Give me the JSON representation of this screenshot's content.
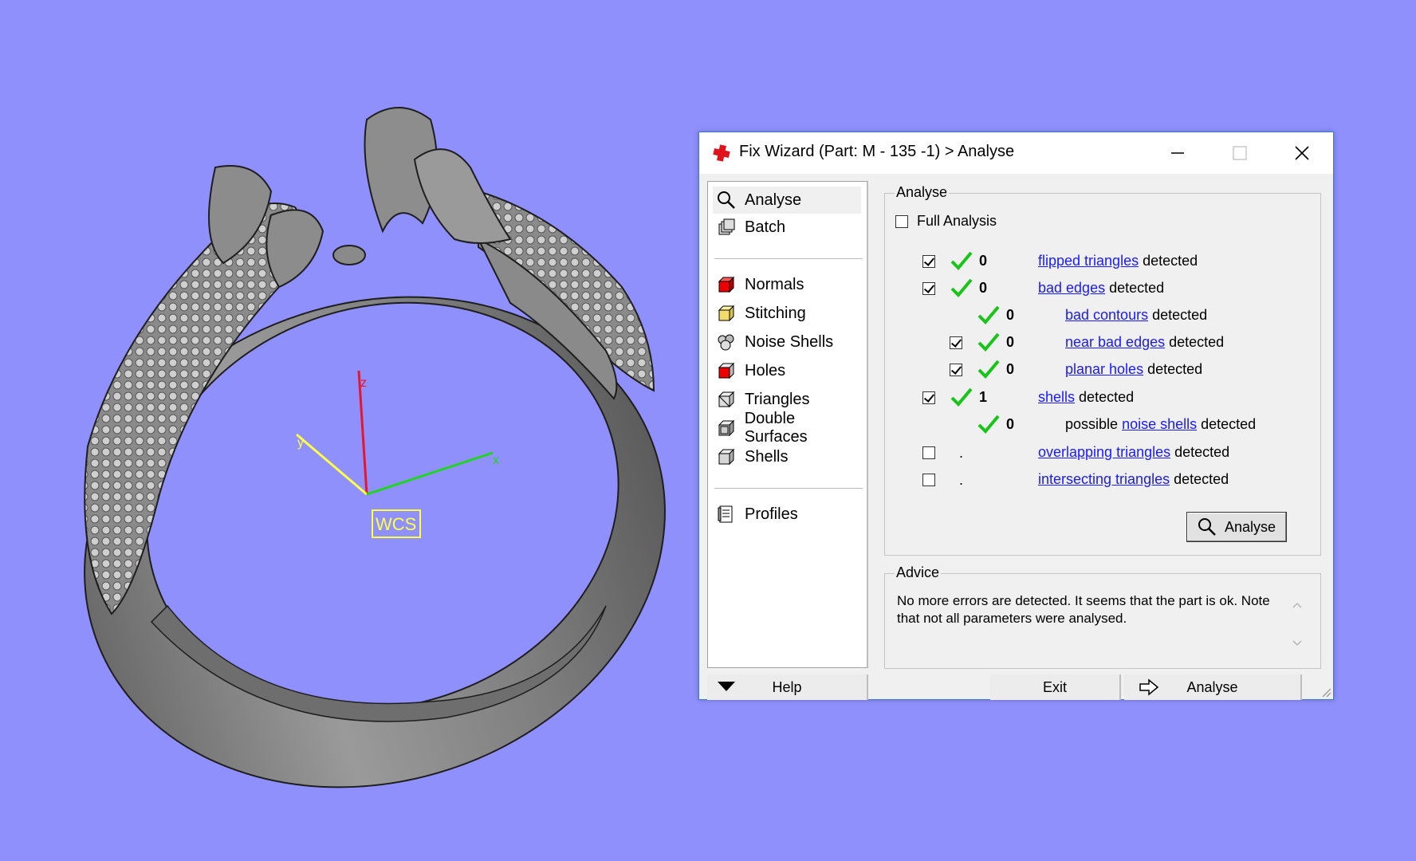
{
  "viewport": {
    "wcs_label": "WCS",
    "axis_x": "x",
    "axis_y": "y",
    "axis_z": "z"
  },
  "window": {
    "title": "Fix Wizard (Part: M - 135 -1) > Analyse",
    "minimize_symbol": "—",
    "maximize_symbol": "☐",
    "close_symbol": "✕"
  },
  "nav": {
    "items": [
      {
        "label": "Analyse",
        "icon": "magnifier-icon"
      },
      {
        "label": "Batch",
        "icon": "batch-icon"
      },
      {
        "label": "Normals",
        "icon": "normals-cube-icon"
      },
      {
        "label": "Stitching",
        "icon": "stitching-cube-icon"
      },
      {
        "label": "Noise Shells",
        "icon": "noise-shells-icon"
      },
      {
        "label": "Holes",
        "icon": "holes-cube-icon"
      },
      {
        "label": "Triangles",
        "icon": "triangles-cube-icon"
      },
      {
        "label": "Double Surfaces",
        "icon": "double-surfaces-icon"
      },
      {
        "label": "Shells",
        "icon": "shells-cube-icon"
      },
      {
        "label": "Profiles",
        "icon": "profiles-icon"
      }
    ]
  },
  "analyse": {
    "group_title": "Analyse",
    "full_analysis_label": "Full Analysis",
    "full_analysis_checked": false,
    "rows": [
      {
        "checked": true,
        "count": "0",
        "link": "flipped triangles",
        "suffix": "detected"
      },
      {
        "checked": true,
        "count": "0",
        "link": "bad edges",
        "suffix": "detected"
      },
      {
        "count": "0",
        "link": "bad contours",
        "suffix": "detected"
      },
      {
        "checked": true,
        "count": "0",
        "link": "near bad edges",
        "suffix": "detected"
      },
      {
        "checked": true,
        "count": "0",
        "link": "planar holes",
        "suffix": "detected"
      },
      {
        "checked": true,
        "count": "1",
        "link": "shells",
        "suffix": "detected"
      },
      {
        "count": "0",
        "prefix": "possible",
        "link": "noise shells",
        "suffix": "detected"
      },
      {
        "checked": false,
        "count": ".",
        "link": "overlapping triangles",
        "suffix": "detected"
      },
      {
        "checked": false,
        "count": ".",
        "link": "intersecting triangles",
        "suffix": "detected"
      }
    ],
    "analyse_button": "Analyse"
  },
  "advice": {
    "group_title": "Advice",
    "text": "No more errors are detected. It seems that the part is ok. Note that not all parameters were analysed."
  },
  "footer": {
    "help_label": "Help",
    "exit_label": "Exit",
    "analyse_label": "Analyse"
  },
  "colors": {
    "background": "#8f90fb",
    "link": "#1a1aff",
    "check_green": "#17c417",
    "axis_x": "#22d422",
    "axis_y": "#ffff44",
    "axis_z": "#e8162b"
  }
}
